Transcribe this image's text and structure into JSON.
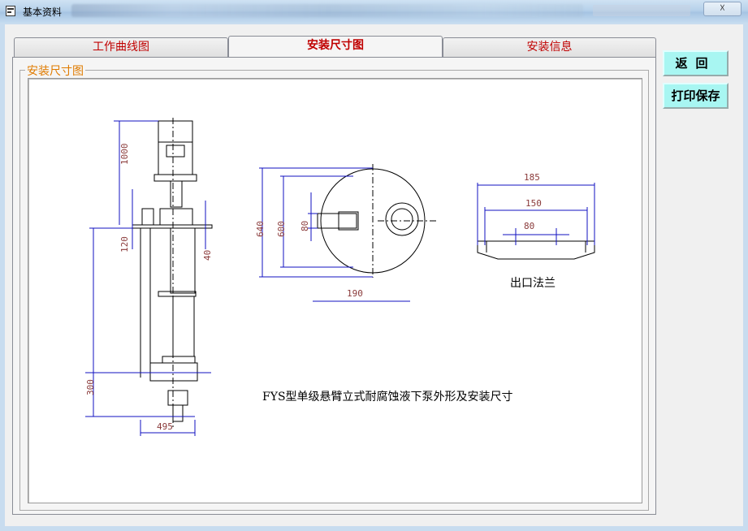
{
  "window": {
    "title": "基本资料",
    "close_glyph": "☓"
  },
  "tabs": [
    {
      "label": "工作曲线图",
      "active": false
    },
    {
      "label": "安装尺寸图",
      "active": true
    },
    {
      "label": "安装信息",
      "active": false
    }
  ],
  "group": {
    "label": "安装尺寸图"
  },
  "buttons": {
    "back": "返回",
    "print_save": "打印保存"
  },
  "drawing": {
    "caption": "FYS型单级悬臂立式耐腐蚀液下泵外形及安装尺寸",
    "flange_caption": "出口法兰",
    "dims_side": [
      "1000",
      "120",
      "40",
      "300",
      "495"
    ],
    "dims_top": [
      "640",
      "600",
      "80",
      "190"
    ],
    "dims_flange": [
      "185",
      "150",
      "80"
    ]
  },
  "colors": {
    "tab_text": "#c00000",
    "group_label": "#e07b00",
    "button_bg": "#a8f6f2",
    "dim_line": "#1010c0"
  }
}
